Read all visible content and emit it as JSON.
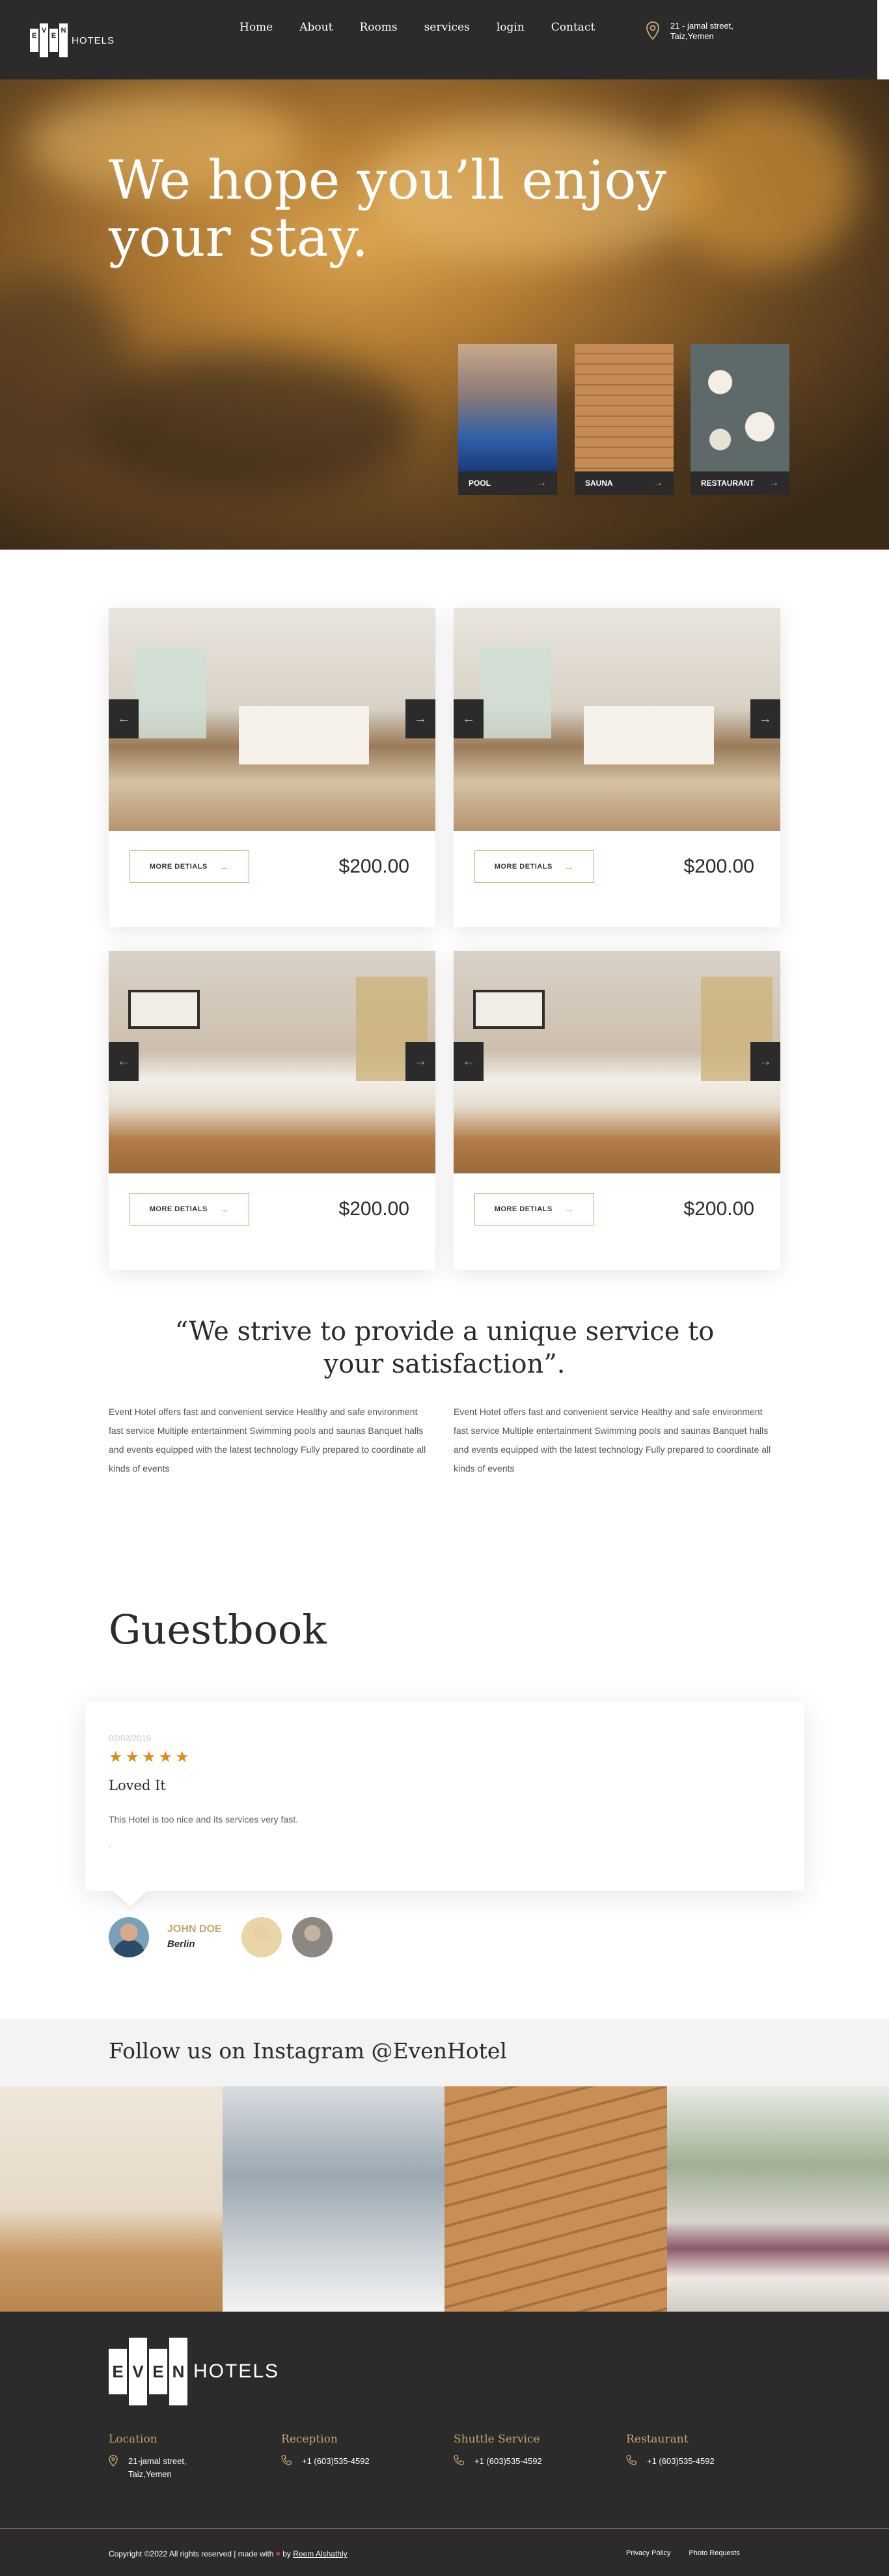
{
  "header": {
    "logo_letters": [
      "E",
      "V",
      "E",
      "N"
    ],
    "logo_suffix": "HOTELS",
    "nav": [
      "Home",
      "About",
      "Rooms",
      "services",
      "login",
      "Contact"
    ],
    "address_line1": "21 - jamal street,",
    "address_line2": "Taiz,Yemen"
  },
  "hero": {
    "title_line1": "We hope you’ll enjoy",
    "title_line2": "your stay.",
    "features": [
      "POOL",
      "SAUNA",
      "RESTAURANT"
    ]
  },
  "rooms": [
    {
      "button": "MORE DETIALS",
      "price": "$200.00"
    },
    {
      "button": "MORE DETIALS",
      "price": "$200.00"
    },
    {
      "button": "MORE DETIALS",
      "price": "$200.00"
    },
    {
      "button": "MORE DETIALS",
      "price": "$200.00"
    }
  ],
  "about": {
    "quote_line1": "“We strive to provide a unique service to",
    "quote_line2": "your satisfaction”.",
    "para_left": "Event Hotel offers fast and convenient service Healthy and safe environment fast service Multiple entertainment Swimming pools and saunas Banquet halls and events equipped with the latest technology Fully prepared to coordinate all kinds of events",
    "para_right": "Event Hotel offers fast and convenient service Healthy and safe environment fast service Multiple entertainment Swimming pools and saunas Banquet halls and events equipped with the latest technology Fully prepared to coordinate all kinds of events"
  },
  "guestbook": {
    "title": "Guestbook",
    "review": {
      "date": "02/02/2019",
      "stars": "★★★★★",
      "rating": 5,
      "title": "Loved It",
      "text": "This Hotel is too nice and its services very fast.",
      "extra": "."
    },
    "guest_name": "JOHN DOE",
    "guest_city": "Berlin"
  },
  "instagram": {
    "title": "Follow us on Instagram @EvenHotel"
  },
  "footer": {
    "logo_letters": [
      "E",
      "V",
      "E",
      "N"
    ],
    "logo_suffix": "HOTELS",
    "columns": [
      {
        "heading": "Location",
        "line1": "21-jamal street,",
        "line2": "Taiz,Yemen"
      },
      {
        "heading": "Reception",
        "line1": "+1 (603)535-4592",
        "line2": ""
      },
      {
        "heading": "Shuttle Service",
        "line1": "+1 (603)535-4592",
        "line2": ""
      },
      {
        "heading": "Restaurant",
        "line1": "+1 (603)535-4592",
        "line2": ""
      }
    ],
    "copyright_prefix": "Copyright ©2022 All rights reserved | made with",
    "heart": "♥",
    "by": "by",
    "author": "Reem Alshathly",
    "links": [
      "Privacy Policy",
      "Photo Requests"
    ]
  },
  "colors": {
    "dark": "#2b2b2b",
    "gold": "#c5a46d",
    "star": "#e08a1e"
  }
}
